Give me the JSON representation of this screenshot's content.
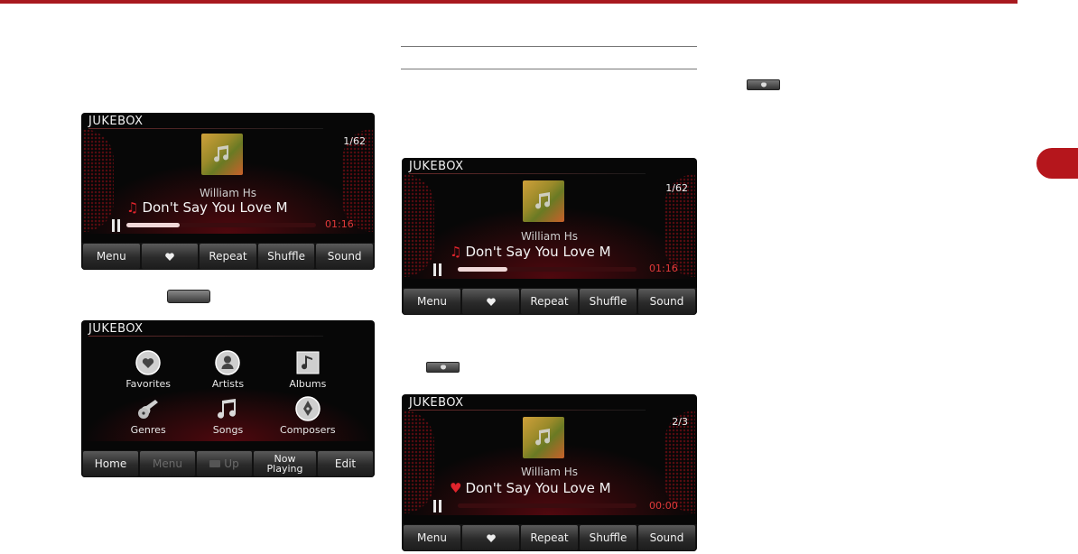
{
  "screens": {
    "now_playing_1": {
      "title": "JUKEBOX",
      "track": "1/62",
      "artist": "William Hs",
      "song": "Don't Say You Love M",
      "time": "01:16",
      "progress": 0.28,
      "buttons": {
        "menu": "Menu",
        "repeat": "Repeat",
        "shuffle": "Shuffle",
        "sound": "Sound"
      }
    },
    "menu_screen": {
      "title": "JUKEBOX",
      "items": {
        "favorites": "Favorites",
        "artists": "Artists",
        "albums": "Albums",
        "genres": "Genres",
        "songs": "Songs",
        "composers": "Composers"
      },
      "buttons": {
        "home": "Home",
        "menu": "Menu",
        "up": "Up",
        "now_playing": "Now Playing",
        "edit": "Edit"
      }
    },
    "now_playing_2": {
      "title": "JUKEBOX",
      "track": "1/62",
      "artist": "William Hs",
      "song": "Don't Say You Love M",
      "time": "01:16",
      "progress": 0.28,
      "buttons": {
        "menu": "Menu",
        "repeat": "Repeat",
        "shuffle": "Shuffle",
        "sound": "Sound"
      }
    },
    "now_playing_3": {
      "title": "JUKEBOX",
      "track": "2/3",
      "artist": "William Hs",
      "song": "Don't Say You Love M",
      "time": "00:00",
      "progress": 0.0,
      "buttons": {
        "menu": "Menu",
        "repeat": "Repeat",
        "shuffle": "Shuffle",
        "sound": "Sound"
      }
    }
  },
  "icons": {
    "favorite": "heart-icon",
    "artists": "person-icon",
    "albums": "music-note-icon",
    "genres": "guitar-icon",
    "songs": "double-note-icon",
    "composers": "pen-nib-icon"
  },
  "colors": {
    "accent": "#a8191f",
    "time_text": "#e23a3a",
    "screen_bg": "#070707"
  }
}
